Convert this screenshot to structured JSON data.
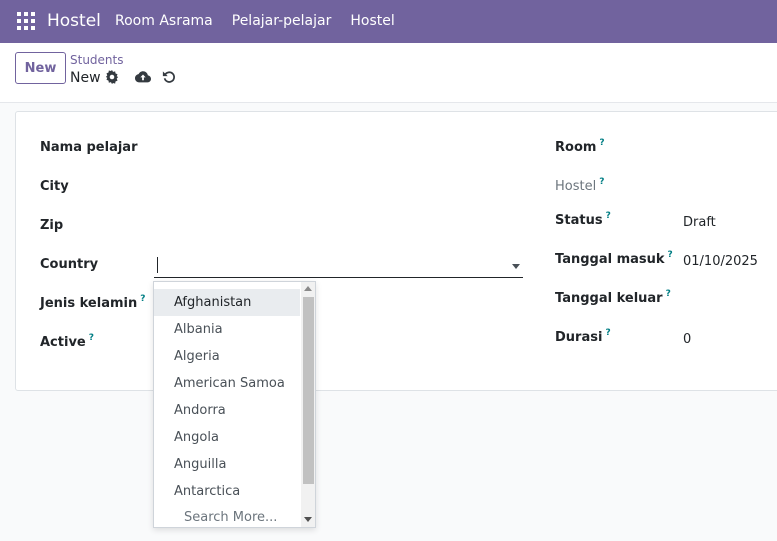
{
  "navbar": {
    "brand": "Hostel",
    "menu": [
      "Room Asrama",
      "Pelajar-pelajar",
      "Hostel"
    ]
  },
  "control": {
    "new_label": "New",
    "breadcrumb_parent": "Students",
    "breadcrumb_current": "New"
  },
  "form": {
    "left_labels": [
      "Nama pelajar",
      "City",
      "Zip",
      "Country",
      "Jenis kelamin",
      "Active"
    ],
    "help_mark": "?",
    "right": {
      "room_label": "Room",
      "hostel_label": "Hostel",
      "status_label": "Status",
      "status_value": "Draft",
      "tanggal_masuk_label": "Tanggal masuk",
      "tanggal_masuk_value": "01/10/2025",
      "tanggal_keluar_label": "Tanggal keluar",
      "durasi_label": "Durasi",
      "durasi_value": "0"
    }
  },
  "dropdown": {
    "options": [
      "Afghanistan",
      "Albania",
      "Algeria",
      "American Samoa",
      "Andorra",
      "Angola",
      "Anguilla",
      "Antarctica"
    ],
    "search_more": "Search More..."
  },
  "colors": {
    "brand": "#71639e",
    "help": "#017e84"
  }
}
